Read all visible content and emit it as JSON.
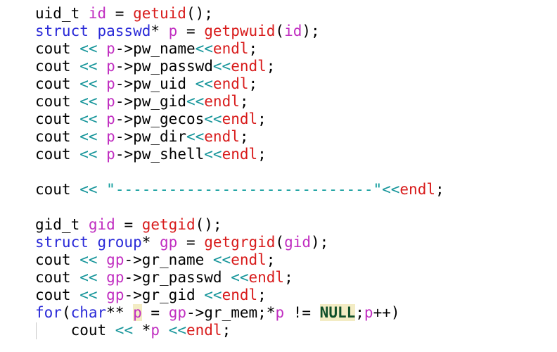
{
  "colors": {
    "background": "#ffffff",
    "plain": "#000000",
    "type_keyword": "#2a2ad8",
    "variable": "#c02dc0",
    "function_call": "#d81b1b",
    "operator": "#16959a",
    "string": "#0f9c9c",
    "constant": "#0f4f2a",
    "highlight": "#f3ecc4"
  },
  "lines": [
    [
      [
        "uid_t ",
        "plain"
      ],
      [
        "id",
        "var"
      ],
      [
        " = ",
        "plain"
      ],
      [
        "getuid",
        "func"
      ],
      [
        "();",
        "plain"
      ]
    ],
    [
      [
        "struct passwd",
        "type"
      ],
      [
        "* ",
        "plain"
      ],
      [
        "p",
        "var"
      ],
      [
        " = ",
        "plain"
      ],
      [
        "getpwuid",
        "func"
      ],
      [
        "(",
        "plain"
      ],
      [
        "id",
        "var"
      ],
      [
        ");",
        "plain"
      ]
    ],
    [
      [
        "cout ",
        "plain"
      ],
      [
        "<<",
        "op"
      ],
      [
        " ",
        "plain"
      ],
      [
        "p",
        "var"
      ],
      [
        "->pw_name",
        "plain"
      ],
      [
        "<<",
        "op"
      ],
      [
        "endl",
        "func"
      ],
      [
        ";",
        "plain"
      ]
    ],
    [
      [
        "cout ",
        "plain"
      ],
      [
        "<<",
        "op"
      ],
      [
        " ",
        "plain"
      ],
      [
        "p",
        "var"
      ],
      [
        "->pw_passwd",
        "plain"
      ],
      [
        "<<",
        "op"
      ],
      [
        "endl",
        "func"
      ],
      [
        ";",
        "plain"
      ]
    ],
    [
      [
        "cout ",
        "plain"
      ],
      [
        "<<",
        "op"
      ],
      [
        " ",
        "plain"
      ],
      [
        "p",
        "var"
      ],
      [
        "->pw_uid ",
        "plain"
      ],
      [
        "<<",
        "op"
      ],
      [
        "endl",
        "func"
      ],
      [
        ";",
        "plain"
      ]
    ],
    [
      [
        "cout ",
        "plain"
      ],
      [
        "<<",
        "op"
      ],
      [
        " ",
        "plain"
      ],
      [
        "p",
        "var"
      ],
      [
        "->pw_gid",
        "plain"
      ],
      [
        "<<",
        "op"
      ],
      [
        "endl",
        "func"
      ],
      [
        ";",
        "plain"
      ]
    ],
    [
      [
        "cout ",
        "plain"
      ],
      [
        "<<",
        "op"
      ],
      [
        " ",
        "plain"
      ],
      [
        "p",
        "var"
      ],
      [
        "->pw_gecos",
        "plain"
      ],
      [
        "<<",
        "op"
      ],
      [
        "endl",
        "func"
      ],
      [
        ";",
        "plain"
      ]
    ],
    [
      [
        "cout ",
        "plain"
      ],
      [
        "<<",
        "op"
      ],
      [
        " ",
        "plain"
      ],
      [
        "p",
        "var"
      ],
      [
        "->pw_dir",
        "plain"
      ],
      [
        "<<",
        "op"
      ],
      [
        "endl",
        "func"
      ],
      [
        ";",
        "plain"
      ]
    ],
    [
      [
        "cout ",
        "plain"
      ],
      [
        "<<",
        "op"
      ],
      [
        " ",
        "plain"
      ],
      [
        "p",
        "var"
      ],
      [
        "->pw_shell",
        "plain"
      ],
      [
        "<<",
        "op"
      ],
      [
        "endl",
        "func"
      ],
      [
        ";",
        "plain"
      ]
    ],
    [],
    [
      [
        "cout ",
        "plain"
      ],
      [
        "<<",
        "op"
      ],
      [
        " ",
        "plain"
      ],
      [
        "\"-----------------------------\"",
        "str"
      ],
      [
        "<<",
        "op"
      ],
      [
        "endl",
        "func"
      ],
      [
        ";",
        "plain"
      ]
    ],
    [],
    [
      [
        "gid_t ",
        "plain"
      ],
      [
        "gid",
        "var"
      ],
      [
        " = ",
        "plain"
      ],
      [
        "getgid",
        "func"
      ],
      [
        "();",
        "plain"
      ]
    ],
    [
      [
        "struct group",
        "type"
      ],
      [
        "* ",
        "plain"
      ],
      [
        "gp",
        "var"
      ],
      [
        " = ",
        "plain"
      ],
      [
        "getgrgid",
        "func"
      ],
      [
        "(",
        "plain"
      ],
      [
        "gid",
        "var"
      ],
      [
        ");",
        "plain"
      ]
    ],
    [
      [
        "cout ",
        "plain"
      ],
      [
        "<<",
        "op"
      ],
      [
        " ",
        "plain"
      ],
      [
        "gp",
        "var"
      ],
      [
        "->gr_name ",
        "plain"
      ],
      [
        "<<",
        "op"
      ],
      [
        "endl",
        "func"
      ],
      [
        ";",
        "plain"
      ]
    ],
    [
      [
        "cout ",
        "plain"
      ],
      [
        "<<",
        "op"
      ],
      [
        " ",
        "plain"
      ],
      [
        "gp",
        "var"
      ],
      [
        "->gr_passwd ",
        "plain"
      ],
      [
        "<<",
        "op"
      ],
      [
        "endl",
        "func"
      ],
      [
        ";",
        "plain"
      ]
    ],
    [
      [
        "cout ",
        "plain"
      ],
      [
        "<<",
        "op"
      ],
      [
        " ",
        "plain"
      ],
      [
        "gp",
        "var"
      ],
      [
        "->gr_gid ",
        "plain"
      ],
      [
        "<<",
        "op"
      ],
      [
        "endl",
        "func"
      ],
      [
        ";",
        "plain"
      ]
    ],
    [
      [
        "for",
        "type"
      ],
      [
        "(",
        "plain"
      ],
      [
        "char",
        "type"
      ],
      [
        "** ",
        "plain"
      ],
      [
        "p",
        "var hl-bg"
      ],
      [
        " = ",
        "plain"
      ],
      [
        "gp",
        "var"
      ],
      [
        "->gr_mem;*",
        "plain"
      ],
      [
        "p",
        "var"
      ],
      [
        " != ",
        "plain"
      ],
      [
        "NULL",
        "const"
      ],
      [
        ";",
        "plain"
      ],
      [
        "p",
        "var"
      ],
      [
        "++)",
        "plain"
      ]
    ],
    [
      [
        "    cout ",
        "plain"
      ],
      [
        "<<",
        "op"
      ],
      [
        " *",
        "plain"
      ],
      [
        "p",
        "var"
      ],
      [
        " ",
        "plain"
      ],
      [
        "<<",
        "op"
      ],
      [
        "endl",
        "func"
      ],
      [
        ";",
        "plain"
      ]
    ]
  ]
}
